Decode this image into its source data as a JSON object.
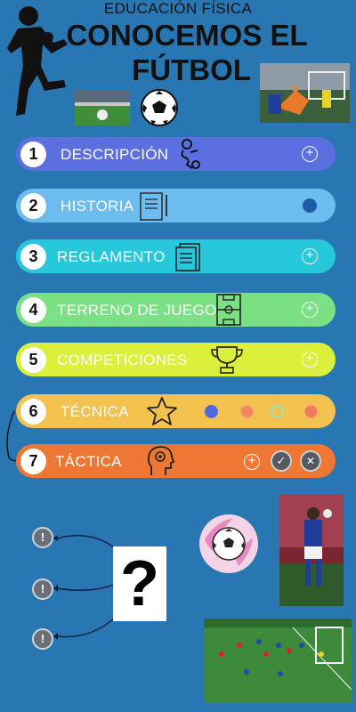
{
  "header": {
    "subtitle": "EDUCACIÓN FÍSICA",
    "title_line1": "CONOCEMOS EL",
    "title_line2": "FÚTBOL"
  },
  "menu": [
    {
      "number": "1",
      "label": "DESCRIPCIÓN",
      "color": "#5b6fe0",
      "icon": "juggling-player-icon",
      "control": "plus"
    },
    {
      "number": "2",
      "label": "HISTORIA",
      "color": "#6cbcf0",
      "icon": "history-book-icon",
      "control": "dot"
    },
    {
      "number": "3",
      "label": "REGLAMENTO",
      "color": "#27c8db",
      "icon": "rules-document-icon",
      "control": "plus"
    },
    {
      "number": "4",
      "label": "TERRENO DE JUEGO",
      "color": "#7ce085",
      "icon": "football-field-icon",
      "control": "plus"
    },
    {
      "number": "5",
      "label": "COMPETICIONES",
      "color": "#dcef3a",
      "icon": "trophy-icon",
      "control": "plus"
    },
    {
      "number": "6",
      "label": "TÉCNICA",
      "color": "#f2c14e",
      "icon": "star-icon",
      "control": "dots"
    },
    {
      "number": "7",
      "label": "TÁCTICA",
      "color": "#ee7733",
      "icon": "tactical-head-icon",
      "control": "plus-check-close"
    }
  ],
  "technique_dots": [
    "#5566dd",
    "#f08860",
    "#8fe8c0",
    "#f07a5a"
  ],
  "question_mark": "?",
  "alert_symbol": "!",
  "plus_symbol": "+",
  "check_symbol": "✓",
  "close_symbol": "✕"
}
